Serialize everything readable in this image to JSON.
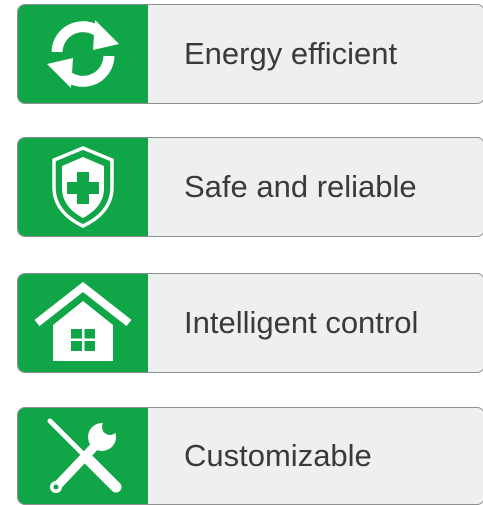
{
  "features": [
    {
      "label": "Energy efficient",
      "icon": "recycle-arrows-icon"
    },
    {
      "label": "Safe and reliable",
      "icon": "shield-cross-icon"
    },
    {
      "label": "Intelligent control",
      "icon": "house-icon"
    },
    {
      "label": "Customizable",
      "icon": "wrench-screwdriver-icon"
    }
  ],
  "colors": {
    "accent": "#10a547",
    "card_bg": "#eef0ef",
    "card_border": "#8f8f8f",
    "text": "#3a3a3a"
  }
}
